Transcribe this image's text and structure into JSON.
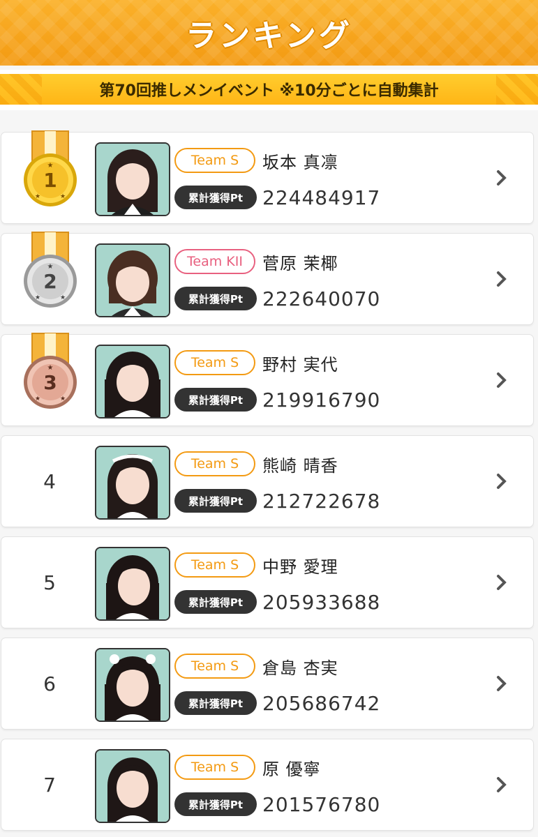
{
  "header": {
    "title": "ランキング"
  },
  "event": {
    "label": "第70回推しメンイベント ※10分ごとに自動集計"
  },
  "colors": {
    "accent": "#f39a12",
    "team_s": "#f39a12",
    "team_kii": "#e8607f"
  },
  "points_label": "累計獲得Pt",
  "ranking": [
    {
      "rank": "1",
      "medal": "gold",
      "team": "Team S",
      "name": "坂本 真凛",
      "points": "224484917"
    },
    {
      "rank": "2",
      "medal": "silver",
      "team": "Team KII",
      "name": "菅原 茉椰",
      "points": "222640070"
    },
    {
      "rank": "3",
      "medal": "bronze",
      "team": "Team S",
      "name": "野村 実代",
      "points": "219916790"
    },
    {
      "rank": "4",
      "medal": "",
      "team": "Team S",
      "name": "熊崎 晴香",
      "points": "212722678"
    },
    {
      "rank": "5",
      "medal": "",
      "team": "Team S",
      "name": "中野 愛理",
      "points": "205933688"
    },
    {
      "rank": "6",
      "medal": "",
      "team": "Team S",
      "name": "倉島 杏実",
      "points": "205686742"
    },
    {
      "rank": "7",
      "medal": "",
      "team": "Team S",
      "name": "原 優寧",
      "points": "201576780"
    }
  ]
}
